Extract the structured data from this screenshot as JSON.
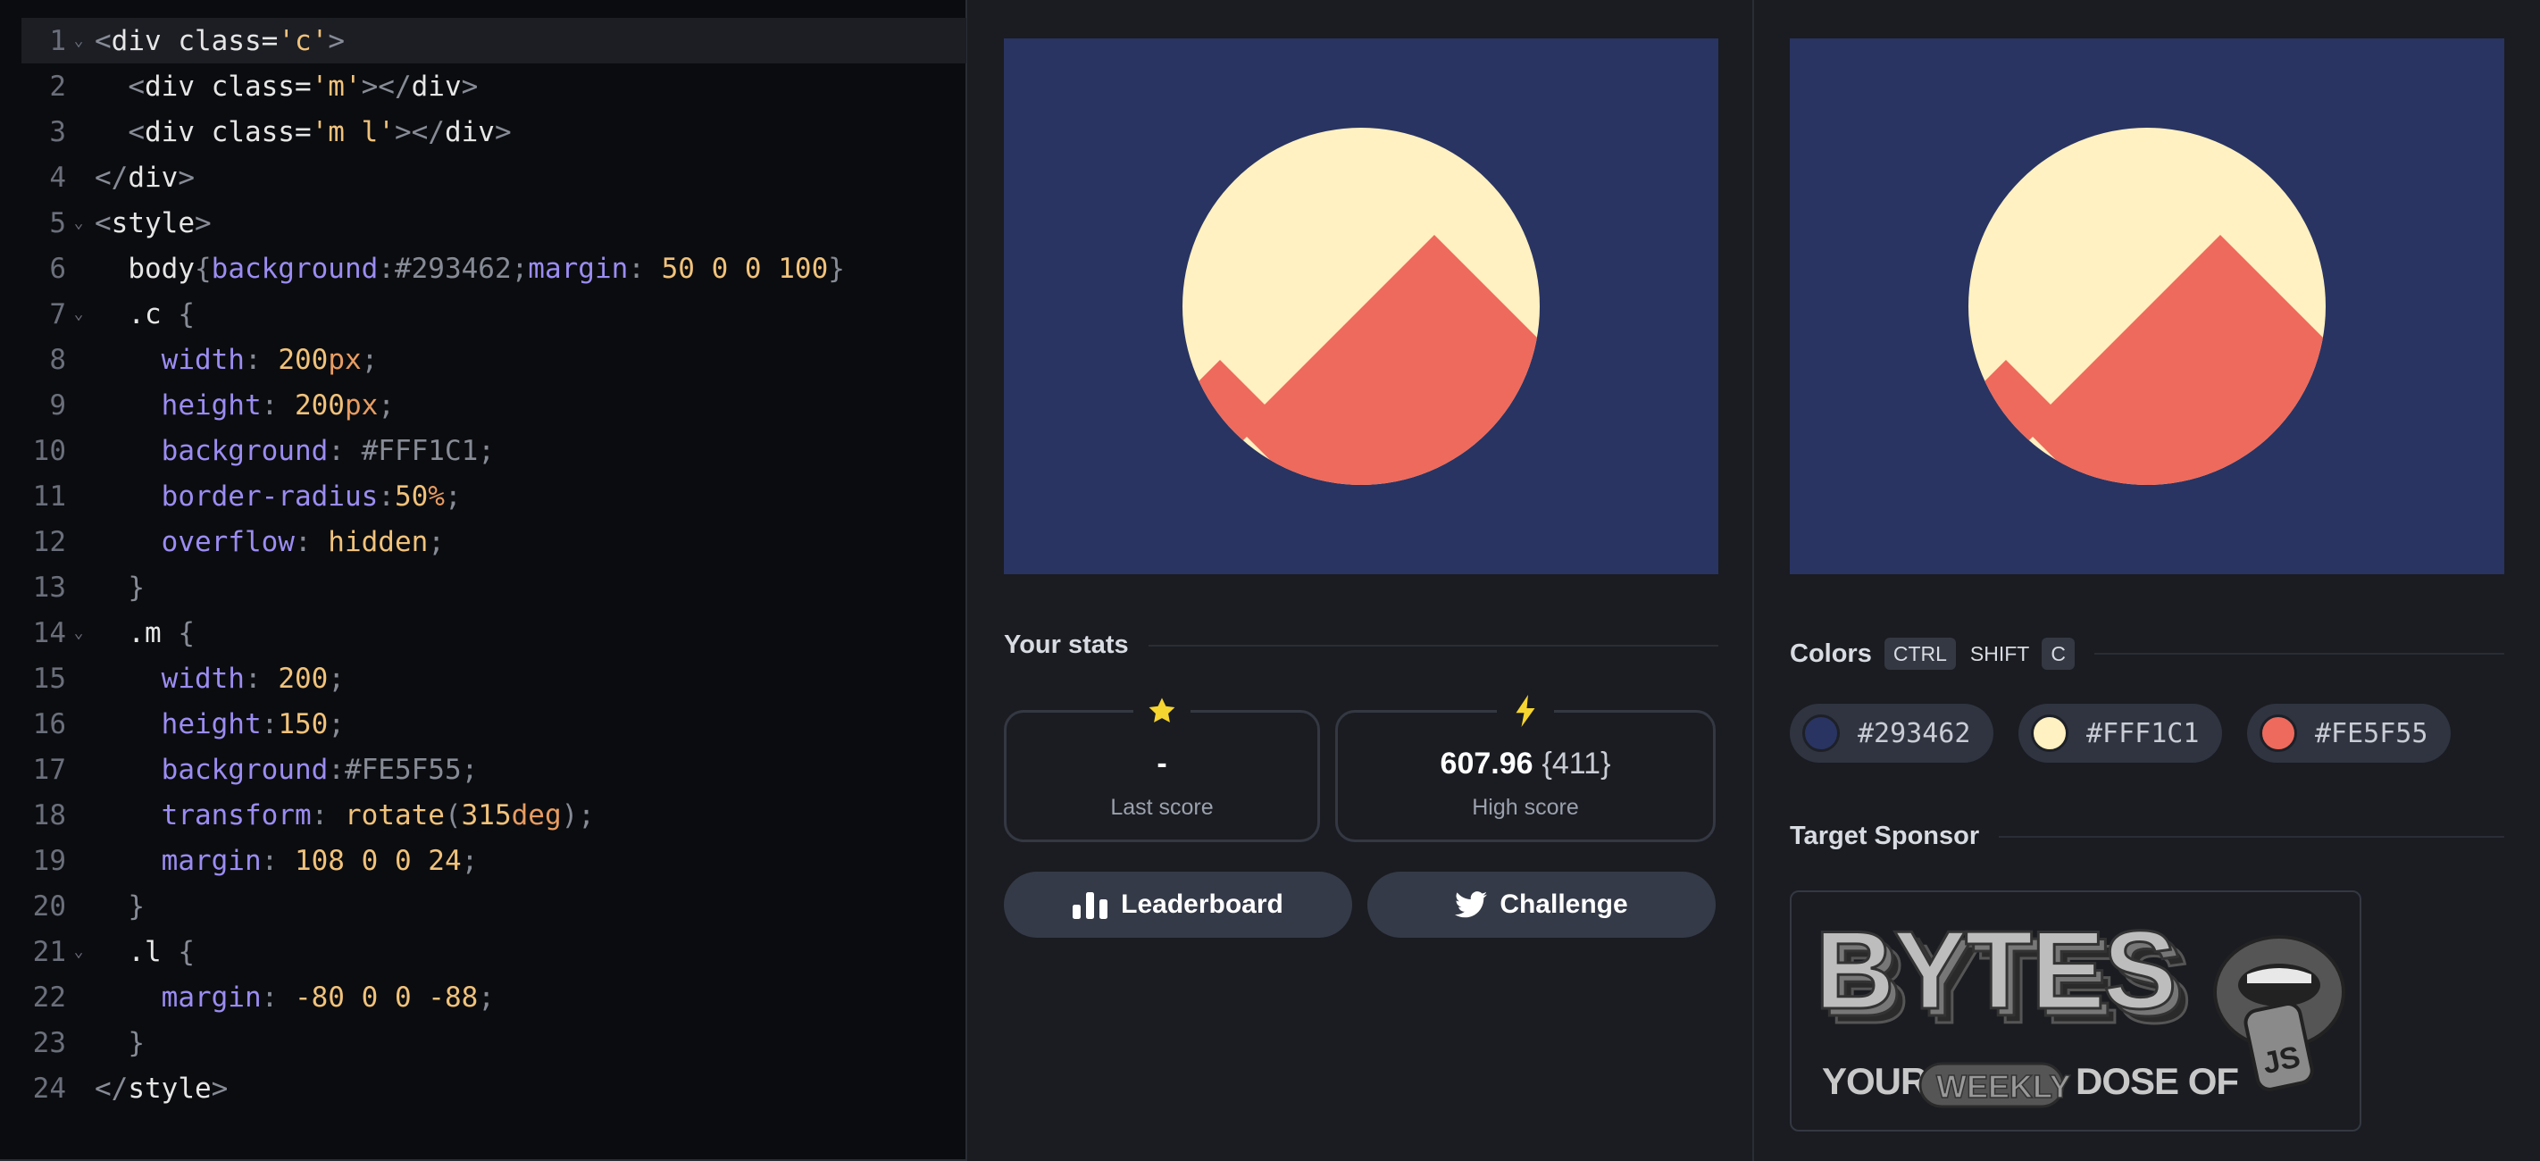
{
  "editor": {
    "lines": [
      {
        "n": "1",
        "tokens": [
          [
            "p",
            "<"
          ],
          [
            "tag",
            "div "
          ],
          [
            "attr",
            "class="
          ],
          [
            "str",
            "'c'"
          ],
          [
            "p",
            ">"
          ]
        ]
      },
      {
        "n": "2",
        "tokens": [
          [
            "p",
            "  <"
          ],
          [
            "tag",
            "div "
          ],
          [
            "attr",
            "class="
          ],
          [
            "str",
            "'m'"
          ],
          [
            "p",
            "></"
          ],
          [
            "tag",
            "div"
          ],
          [
            "p",
            ">"
          ]
        ]
      },
      {
        "n": "3",
        "tokens": [
          [
            "p",
            "  <"
          ],
          [
            "tag",
            "div "
          ],
          [
            "attr",
            "class="
          ],
          [
            "str",
            "'m l'"
          ],
          [
            "p",
            "></"
          ],
          [
            "tag",
            "div"
          ],
          [
            "p",
            ">"
          ]
        ]
      },
      {
        "n": "4",
        "tokens": [
          [
            "p",
            "</"
          ],
          [
            "tag",
            "div"
          ],
          [
            "p",
            ">"
          ]
        ]
      },
      {
        "n": "5",
        "tokens": [
          [
            "p",
            "<"
          ],
          [
            "tag",
            "style"
          ],
          [
            "p",
            ">"
          ]
        ]
      },
      {
        "n": "6",
        "tokens": [
          [
            "sel",
            "  body"
          ],
          [
            "p",
            "{"
          ],
          [
            "prop",
            "background"
          ],
          [
            "p",
            ":"
          ],
          [
            "p",
            "#293462"
          ],
          [
            "p",
            ";"
          ],
          [
            "prop",
            "margin"
          ],
          [
            "p",
            ": "
          ],
          [
            "num",
            "50 0 0 100"
          ],
          [
            "p",
            "}"
          ]
        ]
      },
      {
        "n": "7",
        "tokens": [
          [
            "sel",
            "  .c "
          ],
          [
            "p",
            "{"
          ]
        ]
      },
      {
        "n": "8",
        "tokens": [
          [
            "prop",
            "    width"
          ],
          [
            "p",
            ": "
          ],
          [
            "num",
            "200"
          ],
          [
            "unit",
            "px"
          ],
          [
            "p",
            ";"
          ]
        ]
      },
      {
        "n": "9",
        "tokens": [
          [
            "prop",
            "    height"
          ],
          [
            "p",
            ": "
          ],
          [
            "num",
            "200"
          ],
          [
            "unit",
            "px"
          ],
          [
            "p",
            ";"
          ]
        ]
      },
      {
        "n": "10",
        "tokens": [
          [
            "prop",
            "    background"
          ],
          [
            "p",
            ": "
          ],
          [
            "p",
            "#FFF1C1"
          ],
          [
            "p",
            ";"
          ]
        ]
      },
      {
        "n": "11",
        "tokens": [
          [
            "prop",
            "    border-radius"
          ],
          [
            "p",
            ":"
          ],
          [
            "num",
            "50"
          ],
          [
            "unit",
            "%"
          ],
          [
            "p",
            ";"
          ]
        ]
      },
      {
        "n": "12",
        "tokens": [
          [
            "prop",
            "    overflow"
          ],
          [
            "p",
            ": "
          ],
          [
            "val",
            "hidden"
          ],
          [
            "p",
            ";"
          ]
        ]
      },
      {
        "n": "13",
        "tokens": [
          [
            "p",
            "  }"
          ]
        ]
      },
      {
        "n": "14",
        "tokens": [
          [
            "sel",
            "  .m "
          ],
          [
            "p",
            "{"
          ]
        ]
      },
      {
        "n": "15",
        "tokens": [
          [
            "prop",
            "    width"
          ],
          [
            "p",
            ": "
          ],
          [
            "num",
            "200"
          ],
          [
            "p",
            ";"
          ]
        ]
      },
      {
        "n": "16",
        "tokens": [
          [
            "prop",
            "    height"
          ],
          [
            "p",
            ":"
          ],
          [
            "num",
            "150"
          ],
          [
            "p",
            ";"
          ]
        ]
      },
      {
        "n": "17",
        "tokens": [
          [
            "prop",
            "    background"
          ],
          [
            "p",
            ":"
          ],
          [
            "p",
            "#FE5F55"
          ],
          [
            "p",
            ";"
          ]
        ]
      },
      {
        "n": "18",
        "tokens": [
          [
            "prop",
            "    transform"
          ],
          [
            "p",
            ": "
          ],
          [
            "val",
            "rotate"
          ],
          [
            "p",
            "("
          ],
          [
            "num",
            "315"
          ],
          [
            "unit",
            "deg"
          ],
          [
            "p",
            ");"
          ]
        ]
      },
      {
        "n": "19",
        "tokens": [
          [
            "prop",
            "    margin"
          ],
          [
            "p",
            ": "
          ],
          [
            "num",
            "108 0 0 24"
          ],
          [
            "p",
            ";"
          ]
        ]
      },
      {
        "n": "20",
        "tokens": [
          [
            "p",
            "  }"
          ]
        ]
      },
      {
        "n": "21",
        "tokens": [
          [
            "sel",
            "  .l "
          ],
          [
            "p",
            "{"
          ]
        ]
      },
      {
        "n": "22",
        "tokens": [
          [
            "prop",
            "    margin"
          ],
          [
            "p",
            ": "
          ],
          [
            "num",
            "-80 0 0 -88"
          ],
          [
            "p",
            ";"
          ]
        ]
      },
      {
        "n": "23",
        "tokens": [
          [
            "p",
            "  }"
          ]
        ]
      },
      {
        "n": "24",
        "tokens": [
          [
            "p",
            "</"
          ],
          [
            "tag",
            "style"
          ],
          [
            "p",
            ">"
          ]
        ]
      }
    ],
    "fold_lines": [
      "1",
      "5",
      "7",
      "14",
      "21"
    ],
    "active_line": "1"
  },
  "stats": {
    "title": "Your stats",
    "last_score": {
      "value": "-",
      "label": "Last score",
      "icon": "star-icon"
    },
    "high_score": {
      "value": "607.96",
      "sub": "{411}",
      "label": "High score",
      "icon": "lightning-icon"
    }
  },
  "buttons": {
    "leaderboard": "Leaderboard",
    "challenge": "Challenge"
  },
  "colors": {
    "title": "Colors",
    "shortcut": [
      "CTRL",
      "SHIFT",
      "C"
    ],
    "swatches": [
      {
        "hex": "#293462",
        "label": "#293462"
      },
      {
        "hex": "#FFF1C1",
        "label": "#FFF1C1"
      },
      {
        "hex": "#FE5F55",
        "label": "#FE5F55"
      }
    ]
  },
  "sponsor": {
    "title": "Target Sponsor",
    "logo_text": "BYTES",
    "tagline_1": "YOUR",
    "tagline_2": "WEEKLY",
    "tagline_3": "DOSE OF",
    "badge": "JS"
  },
  "palette": {
    "bg": "#293462",
    "cream": "#FFF1C1",
    "red": "#EE6A5C",
    "panel": "#1a1c21",
    "accent_yellow": "#F7D530"
  }
}
